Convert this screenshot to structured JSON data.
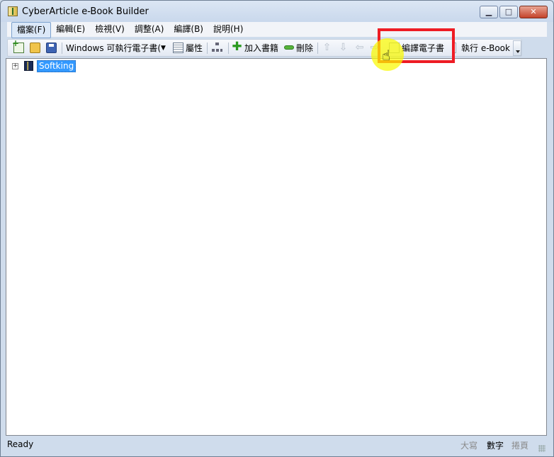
{
  "window": {
    "title": "CyberArticle e-Book Builder"
  },
  "menu": [
    "檔案(F)",
    "編輯(E)",
    "檢視(V)",
    "調整(A)",
    "編譯(B)",
    "說明(H)"
  ],
  "toolbar": {
    "target_select": "Windows 可執行電子書(",
    "properties": "屬性",
    "add_book": "加入書籍",
    "delete": "刪除",
    "compile": "編譯電子書",
    "run": "執行 e-Book"
  },
  "tree": {
    "root": "Softking"
  },
  "status": {
    "ready": "Ready",
    "caps": "大寫",
    "num": "數字",
    "scroll": "捲頁"
  },
  "colors": {
    "highlight": "#ee1c24",
    "selection": "#3399ff"
  }
}
